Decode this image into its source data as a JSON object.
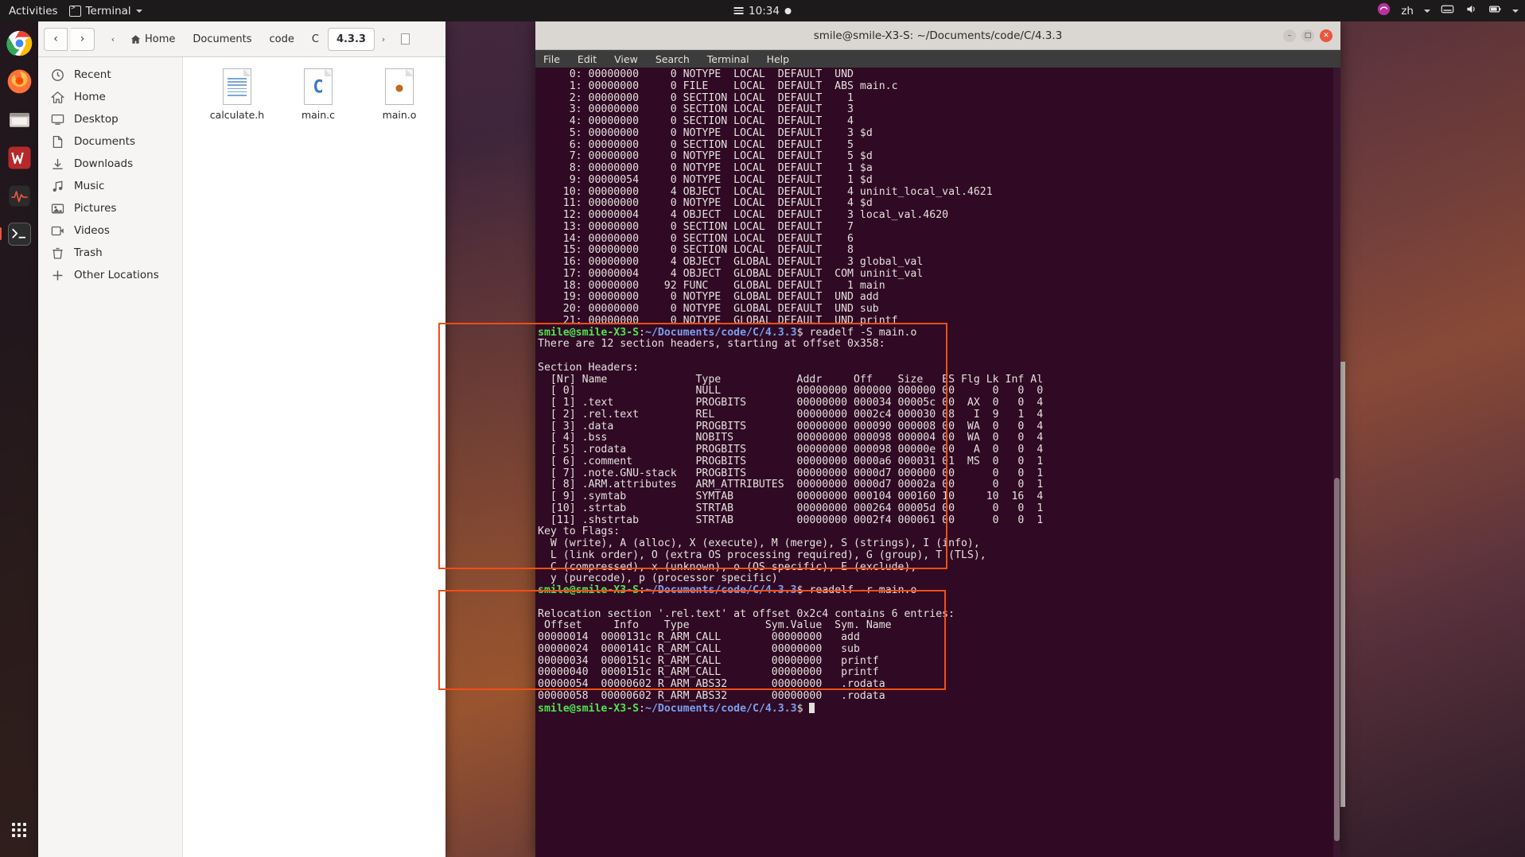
{
  "topbar": {
    "activities": "Activities",
    "app_name": "Terminal",
    "clock": "10:34",
    "language": "zh",
    "icons": [
      "recording-dot",
      "menu-lines",
      "firefox-circle-icon",
      "keyboard-icon",
      "volume-icon",
      "battery-icon",
      "power-chevron-icon"
    ]
  },
  "dock": {
    "items": [
      {
        "name": "chrome",
        "label": "Google Chrome"
      },
      {
        "name": "firefox",
        "label": "Firefox"
      },
      {
        "name": "files",
        "label": "Files"
      },
      {
        "name": "wps",
        "label": "WPS Office"
      },
      {
        "name": "monitor",
        "label": "System Monitor"
      },
      {
        "name": "terminal",
        "label": "Terminal"
      }
    ],
    "show_apps": "Show Applications"
  },
  "files": {
    "nav": {
      "back": "‹",
      "forward": "›"
    },
    "breadcrumbs": [
      {
        "label": "Home",
        "icon": "home-icon",
        "active": false
      },
      {
        "label": "Documents",
        "icon": "",
        "active": false
      },
      {
        "label": "code",
        "icon": "",
        "active": false
      },
      {
        "label": "C",
        "icon": "",
        "active": false
      },
      {
        "label": "4.3.3",
        "icon": "",
        "active": true
      }
    ],
    "sidebar": [
      {
        "label": "Recent",
        "icon": "clock-icon"
      },
      {
        "label": "Home",
        "icon": "home-icon"
      },
      {
        "label": "Desktop",
        "icon": "desktop-icon"
      },
      {
        "label": "Documents",
        "icon": "documents-icon"
      },
      {
        "label": "Downloads",
        "icon": "downloads-icon"
      },
      {
        "label": "Music",
        "icon": "music-icon"
      },
      {
        "label": "Pictures",
        "icon": "pictures-icon"
      },
      {
        "label": "Videos",
        "icon": "videos-icon"
      },
      {
        "label": "Trash",
        "icon": "trash-icon"
      },
      {
        "label": "Other Locations",
        "icon": "plus-icon"
      }
    ],
    "items": [
      {
        "label": "calculate.h",
        "type": "header"
      },
      {
        "label": "main.c",
        "type": "c-source"
      },
      {
        "label": "main.o",
        "type": "object"
      }
    ]
  },
  "terminal": {
    "title": "smile@smile-X3-S: ~/Documents/code/C/4.3.3",
    "menu": [
      "File",
      "Edit",
      "View",
      "Search",
      "Terminal",
      "Help"
    ],
    "window_buttons": [
      "minimize",
      "maximize",
      "close"
    ],
    "prompt_user": "smile@smile-X3-S",
    "prompt_sep": ":",
    "prompt_path": "~/Documents/code/C/4.3.3",
    "prompt_tail": "$",
    "commands": {
      "readelf_s": " readelf -S main.o",
      "readelf_r": " readelf -r main.o",
      "last": " "
    },
    "symtab_lines": [
      "     0: 00000000     0 NOTYPE  LOCAL  DEFAULT  UND ",
      "     1: 00000000     0 FILE    LOCAL  DEFAULT  ABS main.c",
      "     2: 00000000     0 SECTION LOCAL  DEFAULT    1 ",
      "     3: 00000000     0 SECTION LOCAL  DEFAULT    3 ",
      "     4: 00000000     0 SECTION LOCAL  DEFAULT    4 ",
      "     5: 00000000     0 NOTYPE  LOCAL  DEFAULT    3 $d",
      "     6: 00000000     0 SECTION LOCAL  DEFAULT    5 ",
      "     7: 00000000     0 NOTYPE  LOCAL  DEFAULT    5 $d",
      "     8: 00000000     0 NOTYPE  LOCAL  DEFAULT    1 $a",
      "     9: 00000054     0 NOTYPE  LOCAL  DEFAULT    1 $d",
      "    10: 00000000     4 OBJECT  LOCAL  DEFAULT    4 uninit_local_val.4621",
      "    11: 00000000     0 NOTYPE  LOCAL  DEFAULT    4 $d",
      "    12: 00000004     4 OBJECT  LOCAL  DEFAULT    3 local_val.4620",
      "    13: 00000000     0 SECTION LOCAL  DEFAULT    7 ",
      "    14: 00000000     0 SECTION LOCAL  DEFAULT    6 ",
      "    15: 00000000     0 SECTION LOCAL  DEFAULT    8 ",
      "    16: 00000000     4 OBJECT  GLOBAL DEFAULT    3 global_val",
      "    17: 00000004     4 OBJECT  GLOBAL DEFAULT  COM uninit_val",
      "    18: 00000000    92 FUNC    GLOBAL DEFAULT    1 main",
      "    19: 00000000     0 NOTYPE  GLOBAL DEFAULT  UND add",
      "    20: 00000000     0 NOTYPE  GLOBAL DEFAULT  UND sub",
      "    21: 00000000     0 NOTYPE  GLOBAL DEFAULT  UND printf"
    ],
    "section_header_output": [
      "There are 12 section headers, starting at offset 0x358:",
      "",
      "Section Headers:",
      "  [Nr] Name              Type            Addr     Off    Size   ES Flg Lk Inf Al",
      "  [ 0]                   NULL            00000000 000000 000000 00      0   0  0",
      "  [ 1] .text             PROGBITS        00000000 000034 00005c 00  AX  0   0  4",
      "  [ 2] .rel.text         REL             00000000 0002c4 000030 08   I  9   1  4",
      "  [ 3] .data             PROGBITS        00000000 000090 000008 00  WA  0   0  4",
      "  [ 4] .bss              NOBITS          00000000 000098 000004 00  WA  0   0  4",
      "  [ 5] .rodata           PROGBITS        00000000 000098 00000e 00   A  0   0  4",
      "  [ 6] .comment          PROGBITS        00000000 0000a6 000031 01  MS  0   0  1",
      "  [ 7] .note.GNU-stack   PROGBITS        00000000 0000d7 000000 00      0   0  1",
      "  [ 8] .ARM.attributes   ARM_ATTRIBUTES  00000000 0000d7 00002a 00      0   0  1",
      "  [ 9] .symtab           SYMTAB          00000000 000104 000160 10     10  16  4",
      "  [10] .strtab           STRTAB          00000000 000264 00005d 00      0   0  1",
      "  [11] .shstrtab         STRTAB          00000000 0002f4 000061 00      0   0  1",
      "Key to Flags:",
      "  W (write), A (alloc), X (execute), M (merge), S (strings), I (info),",
      "  L (link order), O (extra OS processing required), G (group), T (TLS),",
      "  C (compressed), x (unknown), o (OS specific), E (exclude),",
      "  y (purecode), p (processor specific)"
    ],
    "relocation_output": [
      "Relocation section '.rel.text' at offset 0x2c4 contains 6 entries:",
      " Offset     Info    Type            Sym.Value  Sym. Name",
      "00000014  0000131c R_ARM_CALL        00000000   add",
      "00000024  0000141c R_ARM_CALL        00000000   sub",
      "00000034  0000151c R_ARM_CALL        00000000   printf",
      "00000040  0000151c R_ARM_CALL        00000000   printf",
      "00000054  00000602 R_ARM_ABS32       00000000   .rodata",
      "00000058  00000602 R_ARM_ABS32       00000000   .rodata"
    ]
  },
  "annotations": {
    "highlight_color": "#f24d17",
    "box1_label": "section-headers-highlight",
    "box2_label": "relocation-table-highlight"
  }
}
